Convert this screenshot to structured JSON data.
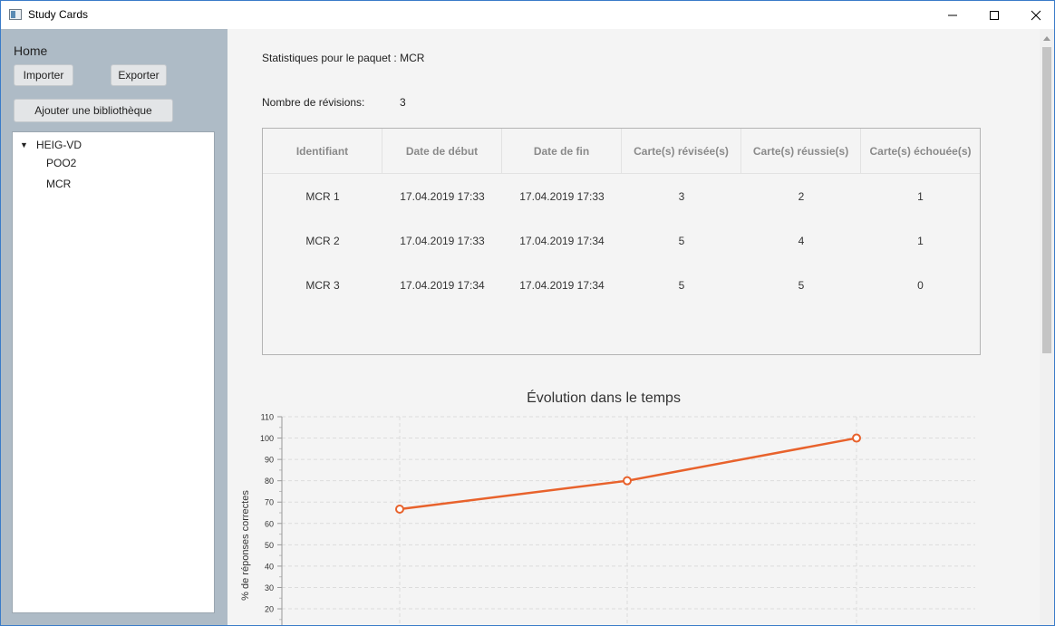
{
  "window": {
    "title": "Study Cards",
    "controls": {
      "minimize_icon": "minimize-icon",
      "maximize_icon": "maximize-icon",
      "close_icon": "close-icon"
    }
  },
  "sidebar": {
    "home_label": "Home",
    "import_label": "Importer",
    "export_label": "Exporter",
    "add_library_label": "Ajouter une bibliothèque",
    "tree": {
      "root": "HEIG-VD",
      "expanded": true,
      "children": [
        "POO2",
        "MCR"
      ]
    }
  },
  "main": {
    "stats_title": "Statistiques pour le paquet : MCR",
    "revisions_label": "Nombre de révisions:",
    "revisions_value": "3",
    "table": {
      "columns": [
        "Identifiant",
        "Date de début",
        "Date de fin",
        "Carte(s) révisée(s)",
        "Carte(s) réussie(s)",
        "Carte(s) échouée(s)"
      ],
      "rows": [
        [
          "MCR  1",
          "17.04.2019 17:33",
          "17.04.2019 17:33",
          "3",
          "2",
          "1"
        ],
        [
          "MCR  2",
          "17.04.2019 17:33",
          "17.04.2019 17:34",
          "5",
          "4",
          "1"
        ],
        [
          "MCR  3",
          "17.04.2019 17:34",
          "17.04.2019 17:34",
          "5",
          "5",
          "0"
        ]
      ]
    }
  },
  "chart_data": {
    "type": "line",
    "title": "Évolution dans le temps",
    "ylabel": "% de réponses correctes",
    "xlabel": "",
    "x": [
      1,
      2,
      3
    ],
    "series": [
      {
        "values": [
          66.7,
          80,
          100
        ],
        "color": "#e8622c"
      }
    ],
    "ylim": [
      0,
      110
    ],
    "yticks": [
      110,
      100,
      90,
      80,
      70,
      60,
      50,
      40,
      30,
      20
    ],
    "grid": true
  }
}
